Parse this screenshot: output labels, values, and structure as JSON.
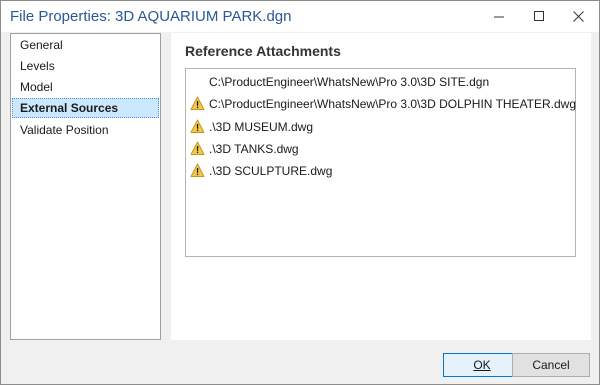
{
  "window": {
    "title": "File Properties: 3D AQUARIUM PARK.dgn",
    "controls": {
      "minimize": "minimize-icon",
      "maximize": "maximize-icon",
      "close": "close-icon"
    }
  },
  "sidebar": {
    "items": [
      {
        "label": "General",
        "selected": false
      },
      {
        "label": "Levels",
        "selected": false
      },
      {
        "label": "Model",
        "selected": false
      },
      {
        "label": "External Sources",
        "selected": true
      },
      {
        "label": "Validate Position",
        "selected": false
      }
    ]
  },
  "main": {
    "heading": "Reference Attachments",
    "references": [
      {
        "path": "C:\\ProductEngineer\\WhatsNew\\Pro 3.0\\3D SITE.dgn",
        "warning": false
      },
      {
        "path": "C:\\ProductEngineer\\WhatsNew\\Pro 3.0\\3D DOLPHIN THEATER.dwg",
        "warning": true
      },
      {
        "path": ".\\3D MUSEUM.dwg",
        "warning": true
      },
      {
        "path": ".\\3D TANKS.dwg",
        "warning": true
      },
      {
        "path": ".\\3D SCULPTURE.dwg",
        "warning": true
      }
    ],
    "warning_icon": "warning-icon"
  },
  "footer": {
    "ok_label": "OK",
    "cancel_label": "Cancel"
  },
  "colors": {
    "title": "#2b5797",
    "selection": "#cce8ff",
    "warning": "#f2c94c",
    "ok_border": "#0078d7"
  }
}
